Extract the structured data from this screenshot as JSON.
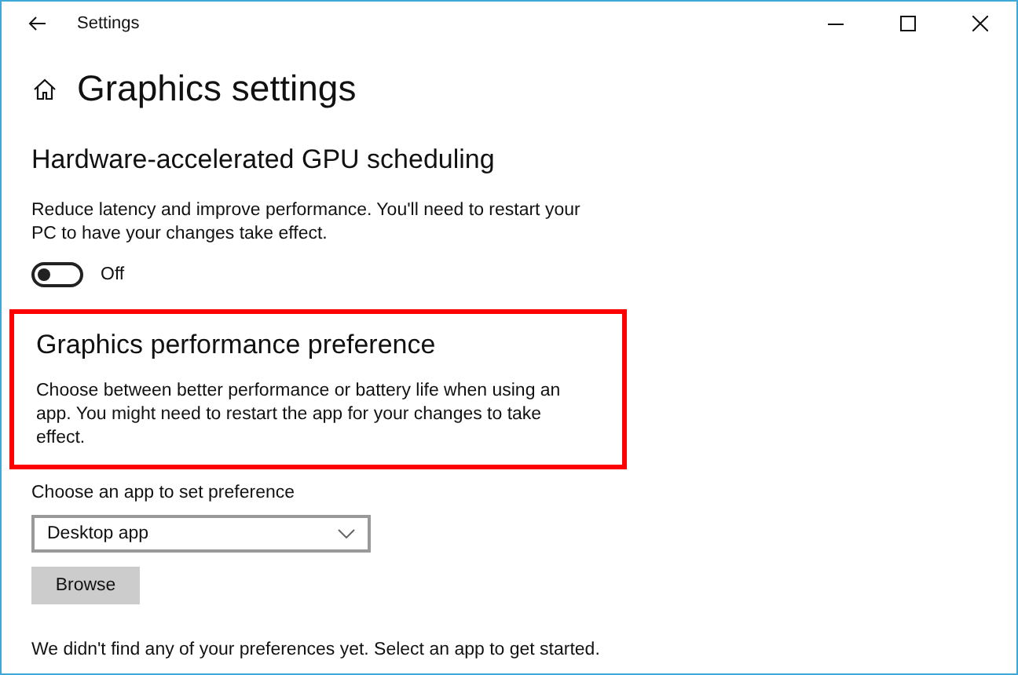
{
  "window": {
    "title": "Settings"
  },
  "page": {
    "title": "Graphics settings"
  },
  "gpu_scheduling": {
    "heading": "Hardware-accelerated GPU scheduling",
    "description": "Reduce latency and improve performance. You'll need to restart your PC to have your changes take effect.",
    "toggle": {
      "on": false,
      "label": "Off"
    }
  },
  "performance_preference": {
    "heading": "Graphics performance preference",
    "description": "Choose between better performance or battery life when using an app. You might need to restart the app for your changes to take effect.",
    "highlighted": true
  },
  "app_choice": {
    "label": "Choose an app to set preference",
    "dropdown": {
      "value": "Desktop app"
    },
    "button": "Browse"
  },
  "status": "We didn't find any of your preferences yet. Select an app to get started."
}
